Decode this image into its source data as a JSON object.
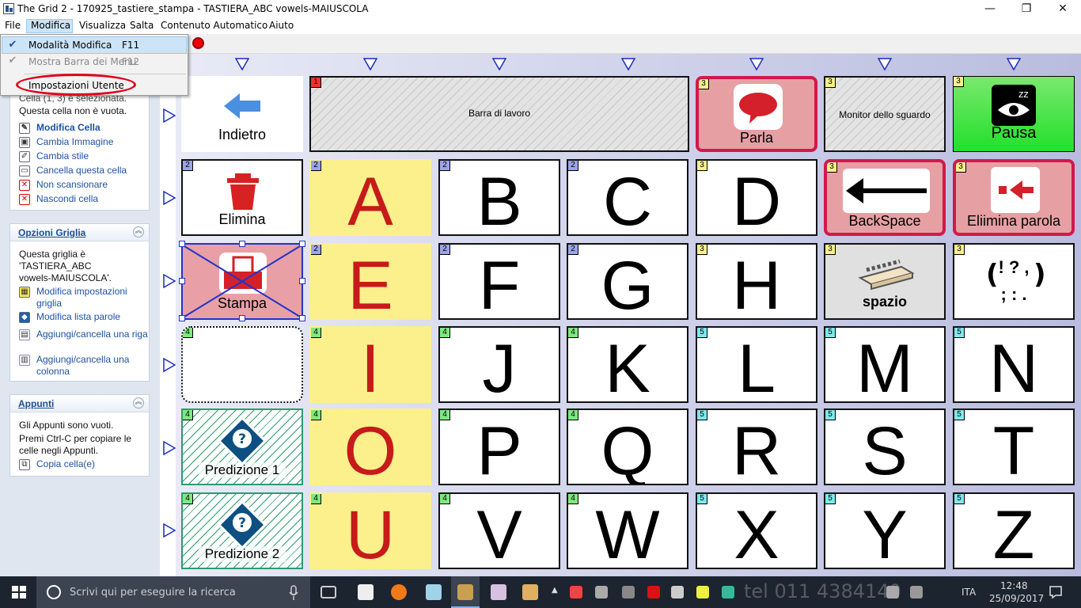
{
  "window": {
    "title": "The Grid 2 - 170925_tastiere_stampa - TASTIERA_ABC vowels-MAIUSCOLA",
    "minimize": "—",
    "maximize": "❐",
    "close": "✕"
  },
  "menubar": [
    "File",
    "Modifica",
    "Visualizza",
    "Salta",
    "Contenuto Automatico",
    "Aiuto"
  ],
  "dropdown": {
    "items": [
      {
        "label": "Modalità Modifica",
        "shortcut": "F11",
        "checked": true,
        "enabled": true
      },
      {
        "label": "Mostra Barra dei Menu",
        "shortcut": "F12",
        "checked": true,
        "enabled": false
      },
      {
        "label": "Impostazioni Utente",
        "shortcut": "",
        "checked": false,
        "enabled": true
      }
    ]
  },
  "sidebar": {
    "cell_panel": {
      "partial_text": "Cella (1, 3) è selezionata.",
      "status": "Questa cella non è vuota.",
      "links": [
        "Modifica Cella",
        "Cambia Immagine",
        "Cambia stile",
        "Cancella questa cella",
        "Non scansionare",
        "Nascondi cella"
      ]
    },
    "grid_panel": {
      "title": "Opzioni Griglia",
      "desc1": "Questa griglia è",
      "desc2": "'TASTIERA_ABC",
      "desc3": "vowels-MAIUSCOLA'.",
      "links": [
        "Modifica impostazioni griglia",
        "Modifica lista parole",
        "Aggiungi/cancella una riga",
        "Aggiungi/cancella una colonna"
      ]
    },
    "clip_panel": {
      "title": "Appunti",
      "line1": "Gli Appunti sono vuoti.",
      "line2": "Premi Ctrl-C per copiare le",
      "line3": "celle negli Appunti.",
      "link": "Copia cella(e)"
    }
  },
  "grid": {
    "top_row": [
      {
        "badge": "",
        "label": "Indietro",
        "style": "white-noborder",
        "icon": "arrow-left-icon"
      },
      {
        "badge": "1",
        "label": "Barra di lavoro",
        "style": "hatch-gray",
        "icon": ""
      },
      {
        "badge": "3",
        "label": "Parla",
        "style": "pink",
        "icon": "speech-bubble-icon"
      },
      {
        "badge": "3",
        "label": "Monitor dello sguardo",
        "style": "hatch-gray",
        "icon": ""
      },
      {
        "badge": "3",
        "label": "Pausa",
        "style": "green",
        "icon": "sleep-eye-icon"
      }
    ],
    "col0": [
      {
        "badge": "2",
        "label": "Elimina",
        "icon": "trash-icon"
      },
      {
        "badge": "",
        "label": "Stampa",
        "icon": "printer-icon"
      },
      {
        "badge": "4",
        "label": "",
        "icon": ""
      },
      {
        "badge": "4",
        "label": "Predizione 1",
        "icon": "question-icon"
      },
      {
        "badge": "4",
        "label": "Predizione 2",
        "icon": "question-icon"
      }
    ],
    "vowels": [
      "A",
      "E",
      "I",
      "O",
      "U"
    ],
    "letters": [
      [
        {
          "l": "B",
          "b": "2"
        },
        {
          "l": "C",
          "b": "2"
        },
        {
          "l": "D",
          "b": "3"
        }
      ],
      [
        {
          "l": "F",
          "b": "2"
        },
        {
          "l": "G",
          "b": "2"
        },
        {
          "l": "H",
          "b": "3"
        }
      ],
      [
        {
          "l": "J",
          "b": "4"
        },
        {
          "l": "K",
          "b": "4"
        },
        {
          "l": "L",
          "b": "5"
        },
        {
          "l": "M",
          "b": "5"
        },
        {
          "l": "N",
          "b": "5"
        }
      ],
      [
        {
          "l": "P",
          "b": "4"
        },
        {
          "l": "Q",
          "b": "4"
        },
        {
          "l": "R",
          "b": "5"
        },
        {
          "l": "S",
          "b": "5"
        },
        {
          "l": "T",
          "b": "5"
        }
      ],
      [
        {
          "l": "V",
          "b": "4"
        },
        {
          "l": "W",
          "b": "4"
        },
        {
          "l": "X",
          "b": "5"
        },
        {
          "l": "Y",
          "b": "5"
        },
        {
          "l": "Z",
          "b": "5"
        }
      ]
    ],
    "backspace": {
      "badge": "3",
      "label": "BackSpace"
    },
    "delete_word": {
      "badge": "3",
      "label": "Eliimina parola"
    },
    "space": {
      "badge": "3",
      "label": "spazio"
    },
    "punct": {
      "badge": "3",
      "line1": "! ? ,",
      "line2": "; : ."
    }
  },
  "taskbar": {
    "search_placeholder": "Scrivi qui per eseguire la ricerca",
    "lang": "ITA",
    "time": "12:48",
    "date": "25/09/2017",
    "watermark": "tel 011 4384140"
  },
  "colors": {
    "accent": "#1d52a3",
    "pink_border": "#d4184a",
    "vowel_bg": "#fbf08c",
    "vowel_text": "#c71a1a",
    "green": "#22e02a"
  }
}
